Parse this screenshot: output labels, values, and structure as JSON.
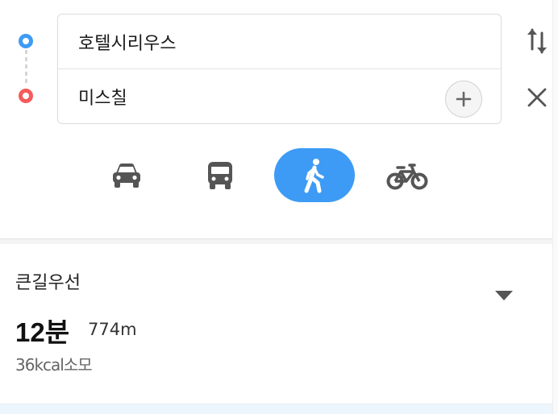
{
  "route": {
    "origin": "호텔시리우스",
    "destination": "미스칠"
  },
  "modes": [
    {
      "name": "car",
      "icon": "car-icon",
      "active": false
    },
    {
      "name": "bus",
      "icon": "bus-icon",
      "active": false
    },
    {
      "name": "walk",
      "icon": "walk-icon",
      "active": true
    },
    {
      "name": "bike",
      "icon": "bike-icon",
      "active": false
    }
  ],
  "result": {
    "route_label": "큰길우선",
    "duration": "12분",
    "distance": "774m",
    "calories": "36kcal소모"
  },
  "colors": {
    "accent": "#3d9bf5",
    "origin_marker": "#3d9bf5",
    "destination_marker": "#f45b5b",
    "icon_gray": "#555555"
  }
}
